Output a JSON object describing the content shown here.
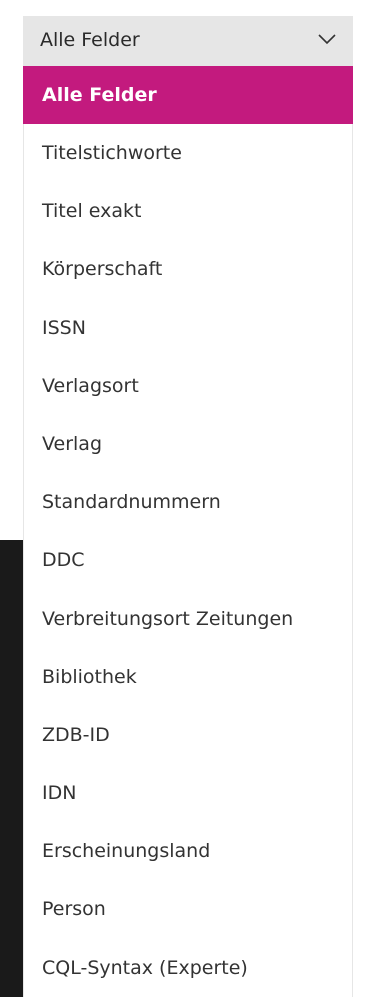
{
  "select": {
    "value": "Alle Felder",
    "icon": "chevron-down-icon"
  },
  "options": [
    {
      "label": "Alle Felder",
      "selected": true
    },
    {
      "label": "Titelstichworte",
      "selected": false
    },
    {
      "label": "Titel exakt",
      "selected": false
    },
    {
      "label": "Körperschaft",
      "selected": false
    },
    {
      "label": "ISSN",
      "selected": false
    },
    {
      "label": "Verlagsort",
      "selected": false
    },
    {
      "label": "Verlag",
      "selected": false
    },
    {
      "label": "Standardnummern",
      "selected": false
    },
    {
      "label": "DDC",
      "selected": false
    },
    {
      "label": "Verbreitungsort Zeitungen",
      "selected": false
    },
    {
      "label": "Bibliothek",
      "selected": false
    },
    {
      "label": "ZDB-ID",
      "selected": false
    },
    {
      "label": "IDN",
      "selected": false
    },
    {
      "label": "Erscheinungsland",
      "selected": false
    },
    {
      "label": "Person",
      "selected": false
    },
    {
      "label": "CQL-Syntax (Experte)",
      "selected": false
    }
  ],
  "colors": {
    "selected_bg": "#c31a7e",
    "select_bg": "#e6e6e6"
  }
}
